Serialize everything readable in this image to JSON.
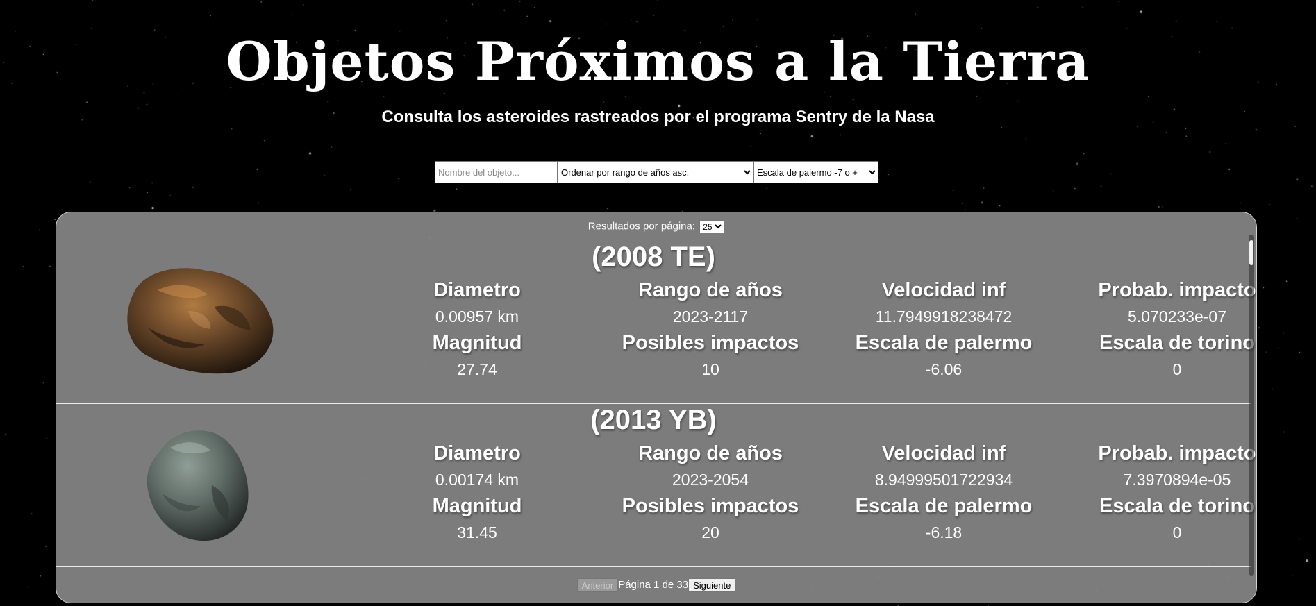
{
  "header": {
    "title": "Objetos Próximos a la Tierra",
    "subtitle": "Consulta los asteroides rastreados por el programa Sentry de la Nasa"
  },
  "filters": {
    "search_placeholder": "Nombre del objeto...",
    "order_selected": "Ordenar por rango de años asc.",
    "palermo_selected": "Escala de palermo -7 o +"
  },
  "results": {
    "per_page_label": "Resultados por página:",
    "per_page_value": "25",
    "labels": {
      "diameter": "Diametro",
      "years": "Rango de años",
      "velocity": "Velocidad inf",
      "probability": "Probab. impacto",
      "magnitude": "Magnitud",
      "impacts": "Posibles impactos",
      "palermo": "Escala de palermo",
      "torino": "Escala de torino"
    },
    "items": [
      {
        "name": "(2008 TE)",
        "diameter": "0.00957 km",
        "years": "2023-2117",
        "velocity": "11.7949918238472",
        "probability": "5.070233e-07",
        "magnitude": "27.74",
        "impacts": "10",
        "palermo": "-6.06",
        "torino": "0",
        "image": "asteroid-brown"
      },
      {
        "name": "(2013 YB)",
        "diameter": "0.00174 km",
        "years": "2023-2054",
        "velocity": "8.94999501722934",
        "probability": "7.3970894e-05",
        "magnitude": "31.45",
        "impacts": "20",
        "palermo": "-6.18",
        "torino": "0",
        "image": "asteroid-gray"
      }
    ]
  },
  "pagination": {
    "prev_label": "Anterior",
    "page_text": "Página 1 de 33",
    "next_label": "Siguiente"
  }
}
